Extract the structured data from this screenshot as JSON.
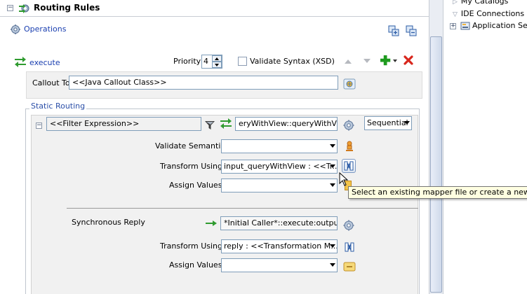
{
  "section": {
    "title": "Routing Rules",
    "collapse_symbol": "⊟"
  },
  "operations": {
    "label": "Operations"
  },
  "rule": {
    "name": "execute",
    "priority_label": "Priority",
    "priority_value": "4",
    "validate_syntax_label": "Validate Syntax (XSD)",
    "validate_syntax_checked": false,
    "callout_label": "Callout To",
    "callout_value": "<<Java Callout Class>>"
  },
  "static_routing": {
    "title": "Static Routing",
    "filter_expression": "<<Filter Expression>>",
    "target": "eryWithView::queryWithView",
    "mode": "Sequential",
    "validate_semantic_label": "Validate Semantic",
    "validate_semantic_value": "",
    "transform_label": "Transform Using",
    "transform_value": "input_queryWithView : <<Tr...",
    "assign_label": "Assign Values",
    "assign_value": "",
    "sync_reply_label": "Synchronous Reply",
    "sync_reply_target": "*Initial Caller*::execute:output",
    "reply_transform_label": "Transform Using",
    "reply_transform_value": "reply : <<Transformation M...",
    "reply_assign_label": "Assign Values",
    "reply_assign_value": ""
  },
  "tooltip": {
    "text": "Select an existing mapper file or create a new one."
  },
  "right_panel": {
    "items": [
      {
        "label": "My Catalogs"
      },
      {
        "label": "IDE Connections"
      },
      {
        "label": "Application Serv"
      }
    ]
  },
  "colors": {
    "accent_blue": "#1a3fb0",
    "add_green": "#1e9a1e",
    "delete_red": "#d8261c",
    "tooltip_bg": "#ffffe1"
  }
}
